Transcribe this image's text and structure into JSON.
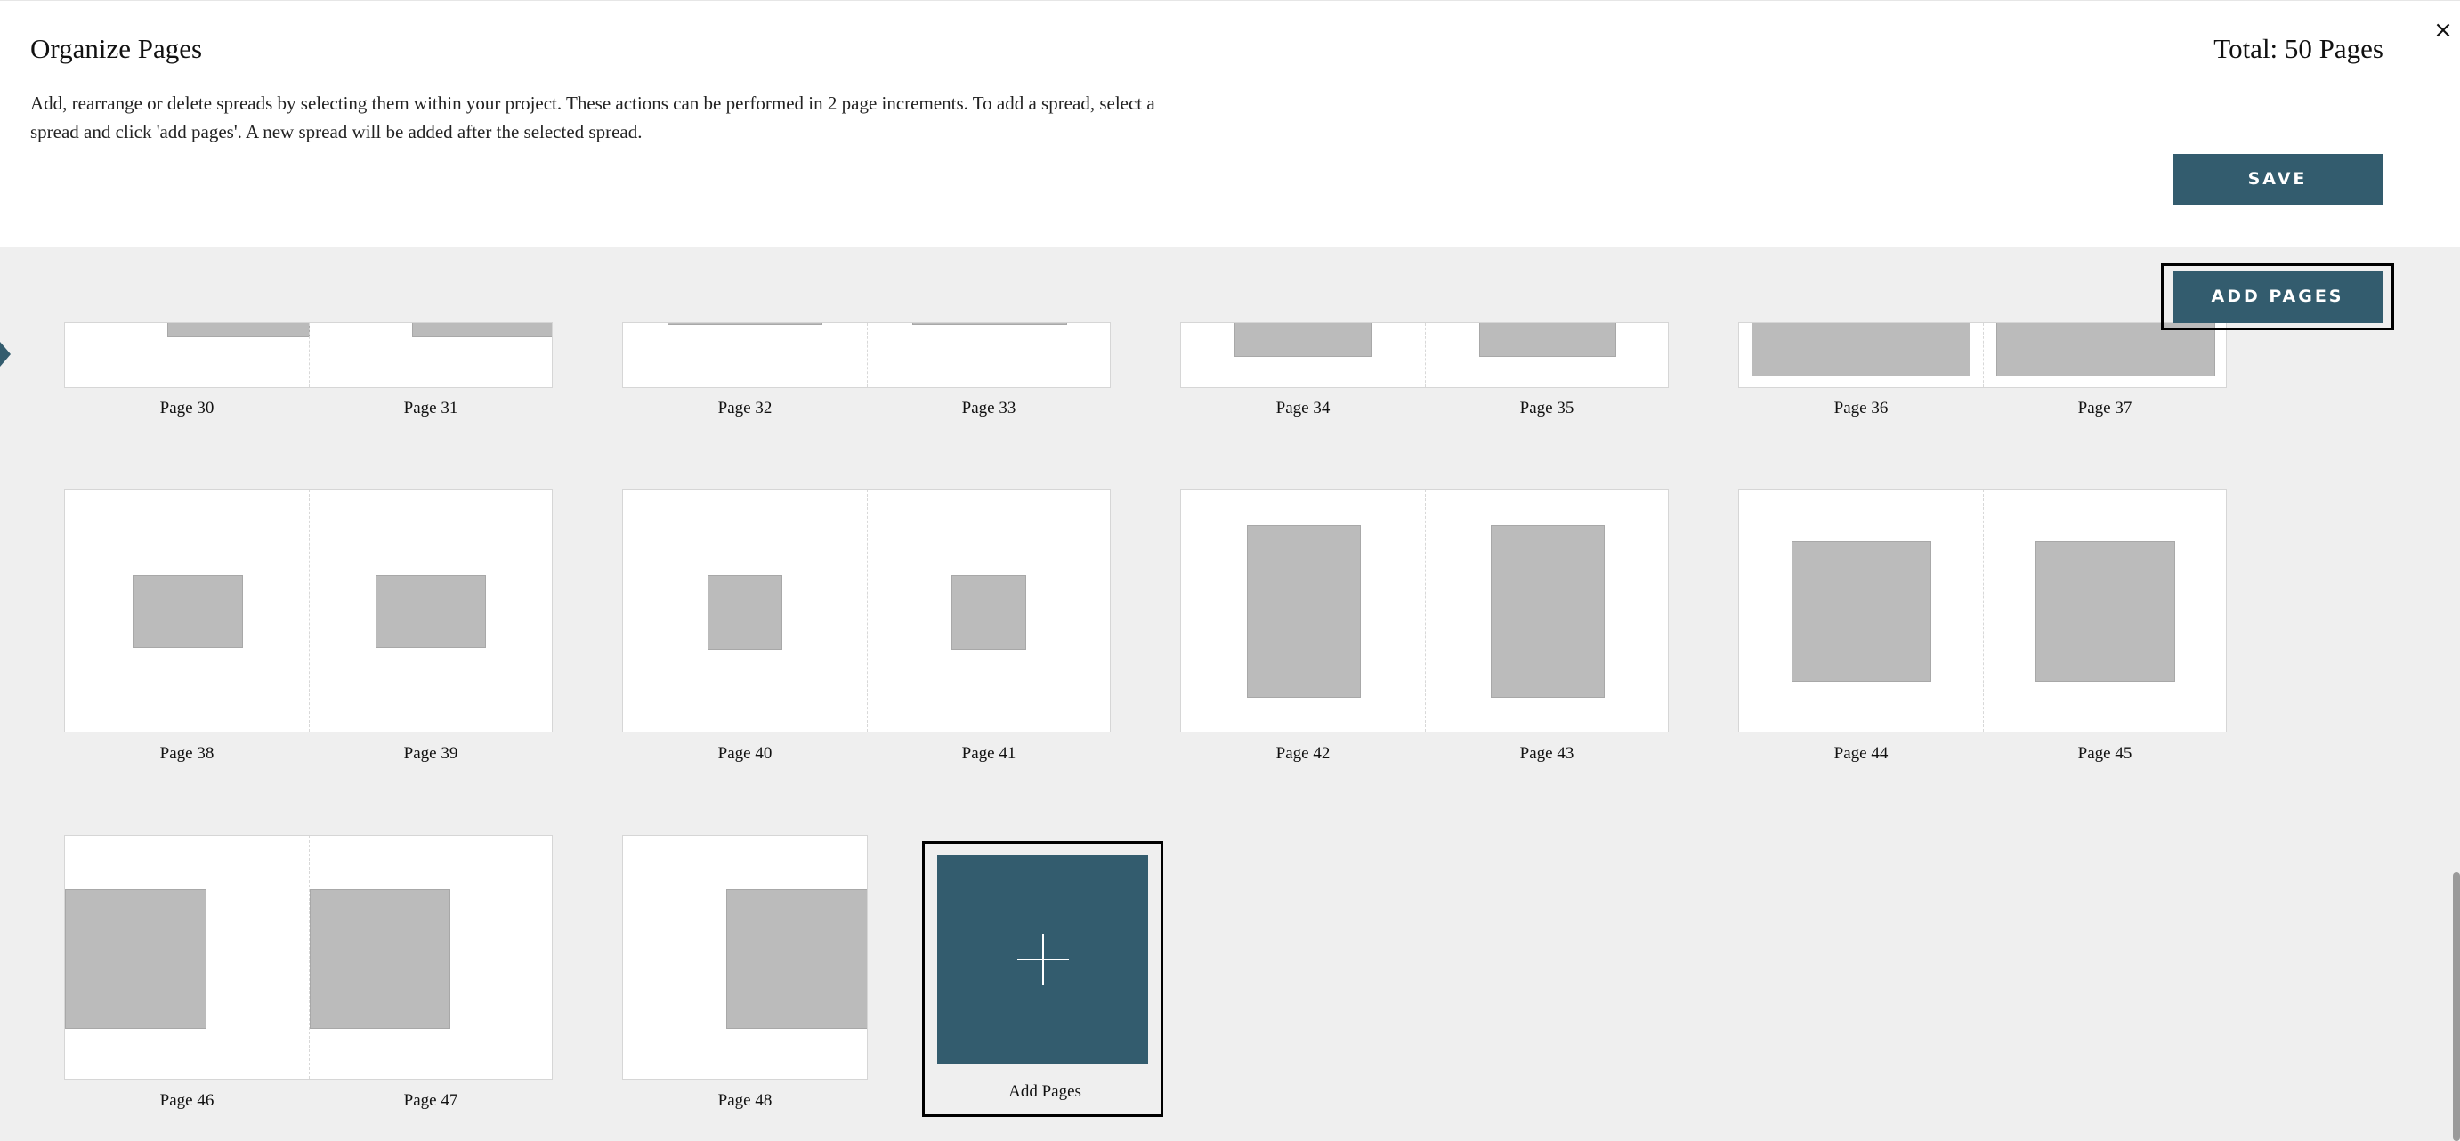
{
  "header": {
    "title": "Organize Pages",
    "description": "Add, rearrange or delete spreads by selecting them within your project. These actions can be performed in 2 page increments. To add a spread, select a spread and click 'add pages'. A new spread will be added after the selected spread.",
    "total": "Total: 50 Pages",
    "close_icon": "×",
    "save_label": "SAVE"
  },
  "toolbar": {
    "add_pages_label": "ADD PAGES"
  },
  "pages": {
    "p30": "Page 30",
    "p31": "Page 31",
    "p32": "Page 32",
    "p33": "Page 33",
    "p34": "Page 34",
    "p35": "Page 35",
    "p36": "Page 36",
    "p37": "Page 37",
    "p38": "Page 38",
    "p39": "Page 39",
    "p40": "Page 40",
    "p41": "Page 41",
    "p42": "Page 42",
    "p43": "Page 43",
    "p44": "Page 44",
    "p45": "Page 45",
    "p46": "Page 46",
    "p47": "Page 47",
    "p48": "Page 48"
  },
  "add_tile": {
    "label": "Add Pages",
    "icon": "plus-icon"
  },
  "colors": {
    "accent": "#335c6e",
    "photo_placeholder": "#bbbbbb",
    "background": "#efefef"
  }
}
